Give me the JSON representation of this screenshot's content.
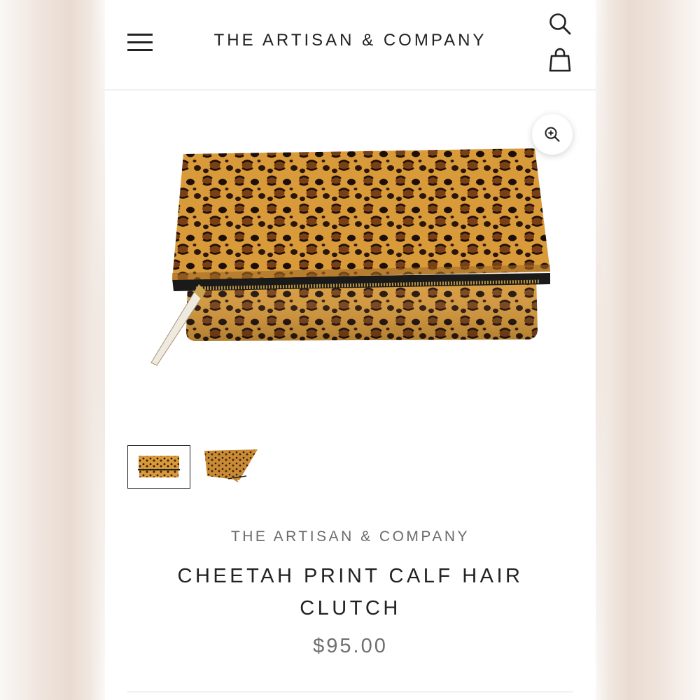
{
  "header": {
    "brand": "THE ARTISAN & COMPANY",
    "menu_icon": "hamburger-menu-icon",
    "search_icon": "search-icon",
    "cart_icon": "shopping-bag-icon"
  },
  "product": {
    "vendor": "THE ARTISAN & COMPANY",
    "title": "CHEETAH PRINT CALF HAIR CLUTCH",
    "price": "$95.00",
    "zoom_icon": "zoom-in-icon",
    "thumbnails": [
      {
        "name": "thumbnail-front",
        "selected": true
      },
      {
        "name": "thumbnail-angled",
        "selected": false
      }
    ]
  },
  "colors": {
    "text": "#222222",
    "muted": "#6b6b6b",
    "divider": "#d9d9d9",
    "leopard_base": "#d99a3a",
    "leopard_spot": "#2a170c",
    "zipper": "#b8913e"
  }
}
